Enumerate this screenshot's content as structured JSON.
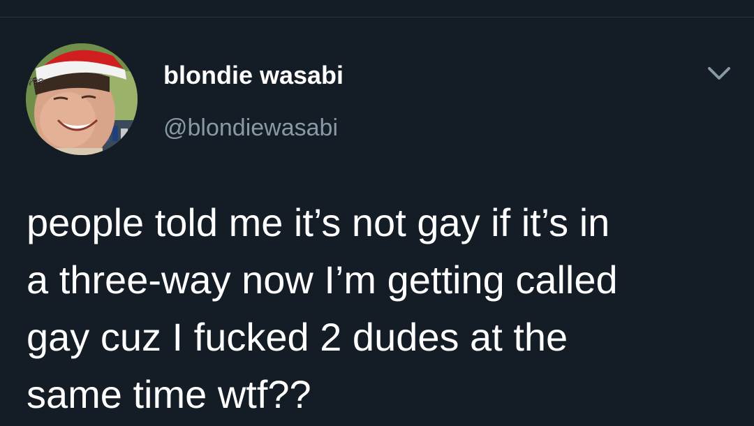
{
  "tweet": {
    "author": {
      "display_name": "blondie wasabi",
      "handle": "@blondiewasabi",
      "avatar_icon": "avatar-photo",
      "avatar_overlay_text": "???"
    },
    "menu_icon": "chevron-down-icon",
    "text_lines": [
      "people told me it’s not gay if it’s in",
      "a three-way now I’m getting called",
      "gay cuz I fucked 2 dudes at the",
      "same time wtf??"
    ]
  },
  "colors": {
    "background": "#141d26",
    "primary_text": "#ffffff",
    "secondary_text": "#8899a6",
    "divider": "#26323d"
  }
}
